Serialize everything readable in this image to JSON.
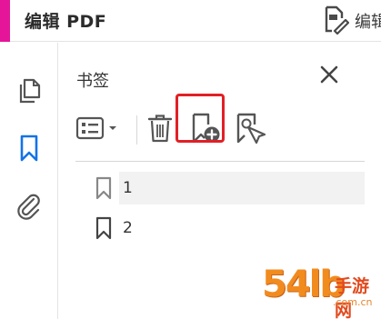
{
  "header": {
    "title": "编辑 PDF",
    "edit_label": "编辑",
    "accent_color": "#e5159a"
  },
  "rail": {
    "items": [
      {
        "icon": "pages-icon"
      },
      {
        "icon": "bookmark-icon",
        "active": true
      },
      {
        "icon": "attachment-icon"
      }
    ],
    "active_color": "#1473e6"
  },
  "panel": {
    "title": "书签",
    "close_icon": "close-icon",
    "toolbar": {
      "buttons": [
        {
          "icon": "list-options-icon"
        },
        {
          "icon": "trash-icon"
        },
        {
          "icon": "add-bookmark-icon",
          "highlighted": true
        },
        {
          "icon": "bookmark-tag-icon"
        }
      ],
      "highlight_color": "#e21f26"
    },
    "bookmarks": [
      {
        "label": "1",
        "selected": true
      },
      {
        "label": "2",
        "selected": false
      }
    ]
  },
  "watermark": {
    "main": "54lb",
    "cn": "手游网",
    "url": ".com.cn"
  }
}
